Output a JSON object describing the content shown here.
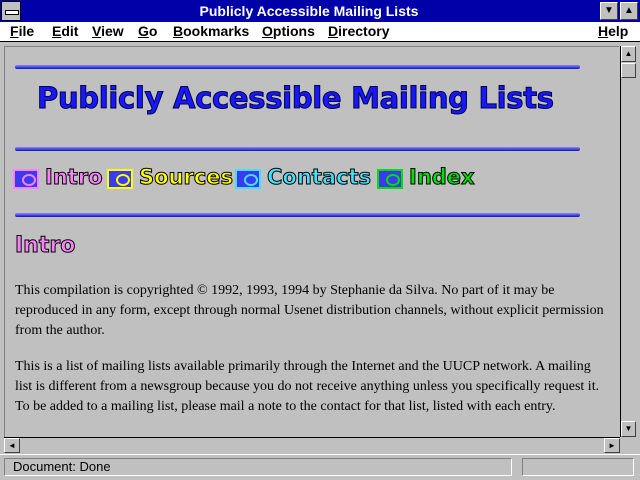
{
  "window": {
    "title": "Publicly Accessible Mailing Lists",
    "minimize_glyph": "▼",
    "maximize_glyph": "▲"
  },
  "menubar": {
    "items": [
      "File",
      "Edit",
      "View",
      "Go",
      "Bookmarks",
      "Options",
      "Directory"
    ],
    "help": "Help"
  },
  "page": {
    "title": "Publicly Accessible Mailing Lists",
    "nav": [
      {
        "label": "Intro",
        "color": "#ff80ff"
      },
      {
        "label": "Sources",
        "color": "#ffff00"
      },
      {
        "label": "Contacts",
        "color": "#40e0ff"
      },
      {
        "label": "Index",
        "color": "#00e000"
      }
    ],
    "section_heading": "Intro",
    "paragraphs": [
      "This compilation is copyrighted © 1992, 1993, 1994 by Stephanie da Silva. No part of it may be reproduced in any form, except through normal Usenet distribution channels, without explicit permission from the author.",
      "This is a list of mailing lists available primarily through the Internet and the UUCP network.  A mailing list is different from a newsgroup because you do not receive anything unless you specifically request it. To be added to a mailing list, please mail a note to the contact for that list, listed with each entry."
    ]
  },
  "scroll": {
    "up": "▲",
    "down": "▼",
    "left": "◄",
    "right": "►"
  },
  "status": {
    "text": "Document: Done"
  }
}
